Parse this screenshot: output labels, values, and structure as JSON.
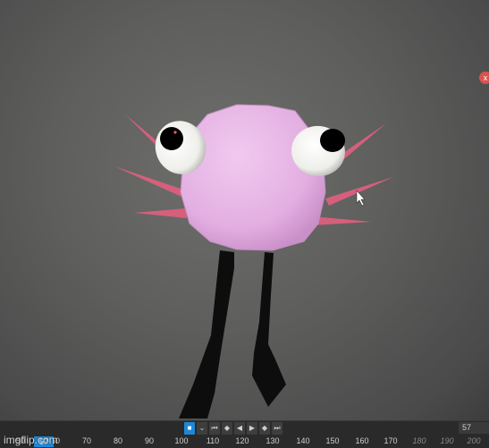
{
  "viewport": {
    "close_icon": "close-icon",
    "close_glyph": "x",
    "character": "pink-blob-creature-with-eyes-and-legs"
  },
  "transport": {
    "buttons": [
      {
        "icon": "key-icon",
        "glyph": "■",
        "active": true
      },
      {
        "icon": "chevron-down-icon",
        "glyph": "⌄",
        "active": false
      },
      {
        "icon": "skip-to-start-icon",
        "glyph": "⏮",
        "active": false
      },
      {
        "icon": "prev-key-icon",
        "glyph": "◆",
        "active": false
      },
      {
        "icon": "play-reverse-icon",
        "glyph": "◀",
        "active": false
      },
      {
        "icon": "play-icon",
        "glyph": "▶",
        "active": false
      },
      {
        "icon": "next-key-icon",
        "glyph": "◆",
        "active": false
      },
      {
        "icon": "skip-to-end-icon",
        "glyph": "⏭",
        "active": false
      }
    ]
  },
  "frame_field": {
    "value": "57"
  },
  "timeline": {
    "current_frame": "57",
    "ticks": [
      "50",
      "60",
      "70",
      "80",
      "90",
      "100",
      "110",
      "120",
      "130",
      "140",
      "150",
      "160",
      "170",
      "180",
      "190",
      "200"
    ],
    "dim_ticks": [
      "180",
      "190",
      "200"
    ]
  },
  "watermark": "imgflip.com",
  "colors": {
    "accent": "#1e88d6",
    "body_pink": "#e6b4e4",
    "spike_red": "#d65f7c"
  }
}
